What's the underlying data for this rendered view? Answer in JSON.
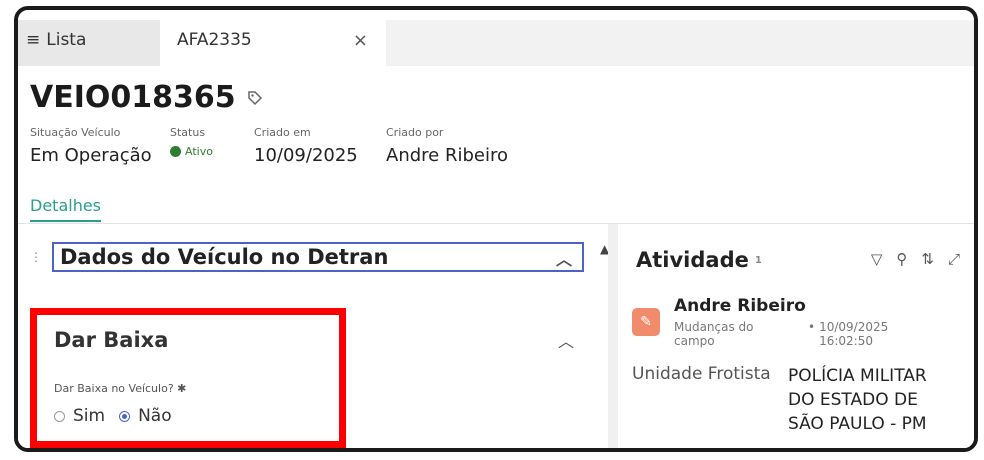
{
  "tabs": {
    "list_label": "Lista",
    "list_icon": "menu-icon",
    "active_label": "AFA2335",
    "close_glyph": "×"
  },
  "record": {
    "title": "VEIO018365",
    "tag_icon": "tag-icon",
    "fields": {
      "situacao_label": "Situação Veículo",
      "situacao_value": "Em Operação",
      "status_label": "Status",
      "status_value": "Ativo",
      "criado_em_label": "Criado em",
      "criado_em_value": "10/09/2025",
      "criado_por_label": "Criado por",
      "criado_por_value": "Andre Ribeiro"
    }
  },
  "detail_tab": "Detalhes",
  "sections": {
    "detran_title": "Dados do Veículo no Detran",
    "baixa_title": "Dar Baixa",
    "baixa_field_label": "Dar Baixa no Veículo? ✱",
    "options": [
      "Sim",
      "Não"
    ],
    "selected": "Não"
  },
  "activity": {
    "title": "Atividade",
    "count": "1",
    "user": "Andre Ribeiro",
    "action": "Mudanças do campo",
    "time": "10/09/2025 16:02:50",
    "field_label": "Unidade Frotista",
    "field_value": "POLÍCIA MILITAR DO ESTADO DE SÃO PAULO - PM"
  },
  "colors": {
    "accent": "#4b63c9",
    "tab_teal": "#2a9d8f",
    "status_green": "#2e7d32",
    "highlight_red": "#ff0000",
    "avatar": "#f28b6c"
  }
}
